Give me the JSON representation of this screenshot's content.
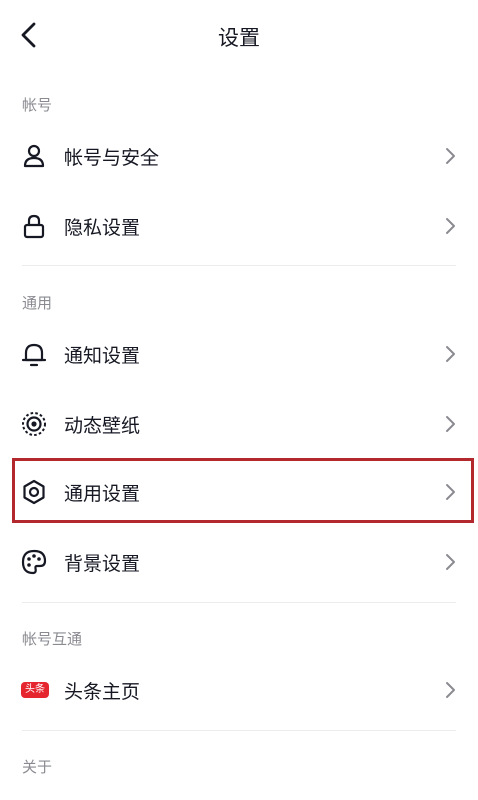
{
  "header": {
    "title": "设置",
    "back_icon": "chevron-left-icon"
  },
  "sections": [
    {
      "label": "帐号",
      "items": [
        {
          "label": "帐号与安全",
          "icon": "user-icon"
        },
        {
          "label": "隐私设置",
          "icon": "lock-icon"
        }
      ]
    },
    {
      "label": "通用",
      "items": [
        {
          "label": "通知设置",
          "icon": "bell-icon"
        },
        {
          "label": "动态壁纸",
          "icon": "live-wallpaper-icon"
        },
        {
          "label": "通用设置",
          "icon": "gear-icon",
          "highlighted": true
        },
        {
          "label": "背景设置",
          "icon": "palette-icon"
        }
      ]
    },
    {
      "label": "帐号互通",
      "items": [
        {
          "label": "头条主页",
          "icon": "toutiao-logo-icon",
          "badge_text": "头条"
        }
      ]
    },
    {
      "label": "关于",
      "items": []
    }
  ],
  "colors": {
    "text": "#161823",
    "section_label": "#8a8b91",
    "divider": "#ececee",
    "highlight_border": "#b3282d",
    "badge_red": "#e6262f"
  }
}
